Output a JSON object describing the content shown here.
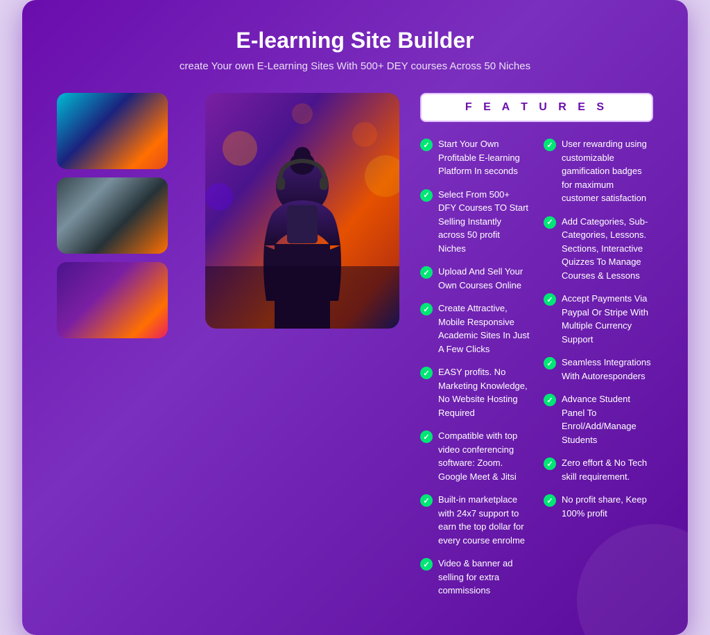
{
  "header": {
    "title": "E-learning Site Builder",
    "subtitle": "create Your own E-Learning Sites With 500+ DEY courses Across 50 Niches"
  },
  "features_label": "F E A T U R E S",
  "features_left": [
    "Start Your Own Profitable E-learning Platform In seconds",
    "Select From 500+ DFY Courses TO Start Selling Instantly across 50 profit Niches",
    "Upload And Sell Your Own Courses Online",
    "Create Attractive, Mobile Responsive Academic Sites In Just A Few Clicks",
    "EASY profits. No Marketing Knowledge, No Website Hosting Required",
    "Compatible with top video conferencing software: Zoom. Google Meet & Jitsi",
    "Built-in marketplace with 24x7 support to earn the top dollar for every course enrolme",
    "Video & banner ad selling for extra commissions"
  ],
  "features_right": [
    "User rewarding using customizable gamification badges for maximum customer satisfaction",
    "Add Categories, Sub-Categories, Lessons. Sections, Interactive Quizzes To Manage Courses & Lessons",
    "Accept Payments Via Paypal Or Stripe With Multiple Currency Support",
    "Seamless Integrations With Autoresponders",
    "Advance Student Panel To Enrol/Add/Manage Students",
    "Zero effort & No Tech skill requirement.",
    "No profit share, Keep 100% profit"
  ]
}
